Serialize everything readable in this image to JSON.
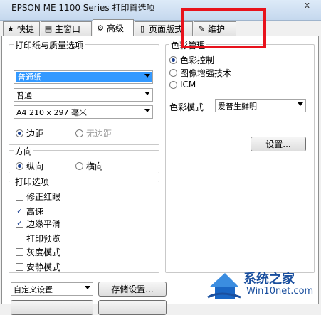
{
  "window": {
    "title": "EPSON ME 1100 Series 打印首选项",
    "close_label": "x"
  },
  "tabs": [
    {
      "label": "快捷",
      "icon": "star-icon"
    },
    {
      "label": "主窗口",
      "icon": "printer-icon"
    },
    {
      "label": "高级",
      "icon": "gear-icon",
      "active": true
    },
    {
      "label": "页面版式",
      "icon": "page-icon"
    },
    {
      "label": "维护",
      "icon": "wrench-icon"
    }
  ],
  "paper": {
    "group_label": "打印纸与质量选项",
    "media_type": "普通纸",
    "quality": "普通",
    "size": "A4 210 x 297 毫米",
    "margin_label": "边距",
    "borderless_label": "无边距"
  },
  "orientation": {
    "group_label": "方向",
    "portrait": "纵向",
    "landscape": "横向"
  },
  "print_options": {
    "group_label": "打印选项",
    "items": [
      {
        "label": "修正红眼",
        "checked": false
      },
      {
        "label": "高速",
        "checked": true
      },
      {
        "label": "边缘平滑",
        "checked": true
      },
      {
        "label": "打印预览",
        "checked": false
      },
      {
        "label": "灰度模式",
        "checked": false
      },
      {
        "label": "安静模式",
        "checked": false
      }
    ]
  },
  "color_mgmt": {
    "group_label": "色彩管理",
    "color_control": "色彩控制",
    "photo_enhance": "图像增强技术",
    "icm": "ICM",
    "mode_label": "色彩模式",
    "mode_value": "爱普生鲜明",
    "settings_button": "设置..."
  },
  "bottom": {
    "custom_value": "自定义设置",
    "save_button": "存储设置..."
  },
  "watermark": {
    "title": "系统之家",
    "url": "Win10net.com"
  },
  "colors": {
    "highlight": "#3399ff",
    "annotation": "#e8121c",
    "watermark": "#1a4f9e"
  }
}
